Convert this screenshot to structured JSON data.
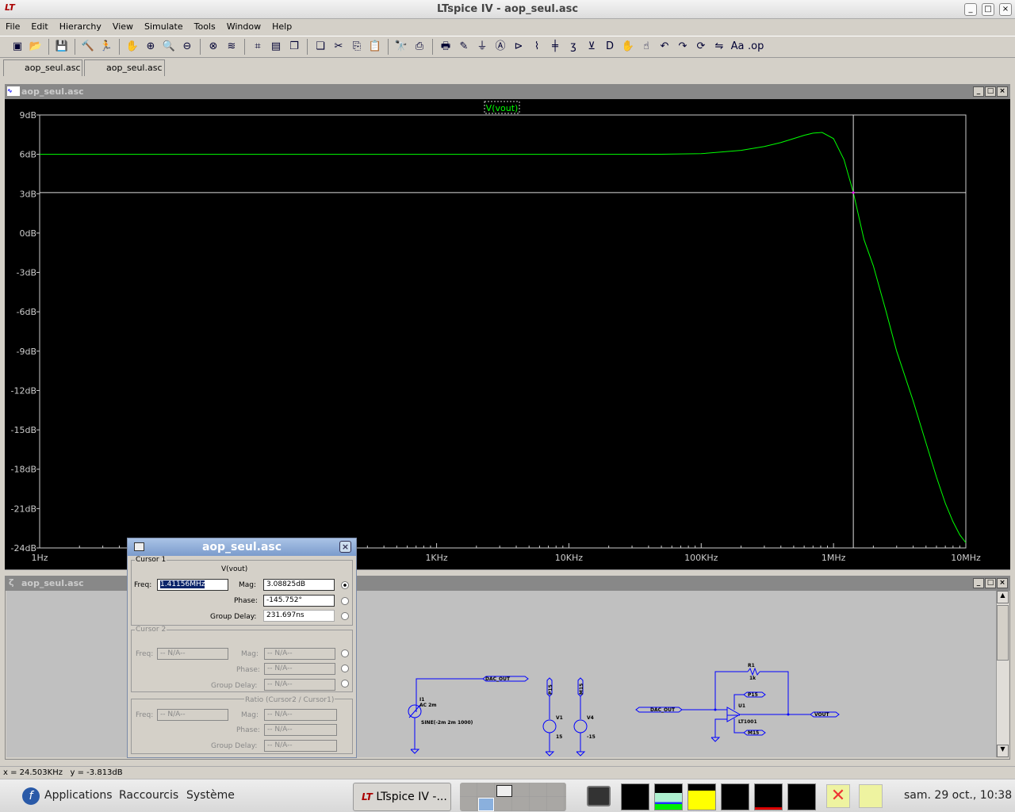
{
  "window": {
    "title": "LTspice IV - aop_seul.asc"
  },
  "menu": [
    "File",
    "Edit",
    "Hierarchy",
    "View",
    "Simulate",
    "Tools",
    "Window",
    "Help"
  ],
  "toolbar": [
    "new-schematic",
    "open",
    "save",
    "control-panel",
    "run",
    "halt",
    "zoom-in",
    "zoom-pan",
    "zoom-out",
    "zoom-cancel",
    "autorange",
    "mark-unref",
    "tile-horizontal",
    "cascade",
    "tile-vertical",
    "cut",
    "copy",
    "paste",
    "find",
    "print-setup",
    "print",
    "draw-wire",
    "ground",
    "label-net",
    "component",
    "resistor",
    "capacitor",
    "inductor",
    "diode",
    "component-add",
    "move",
    "drag",
    "undo",
    "redo",
    "rotate",
    "mirror",
    "text",
    "spice-directive"
  ],
  "tabs": [
    "aop_seul.asc",
    "aop_seul.asc"
  ],
  "plot_window": {
    "title": "aop_seul.asc",
    "trace_label": "V(vout)",
    "trace_color": "#00ff00"
  },
  "chart_data": {
    "type": "line",
    "xscale": "log",
    "xlim": [
      1,
      10000000
    ],
    "ylim": [
      -24,
      9
    ],
    "grid": "off",
    "yticks": [
      "9dB",
      "6dB",
      "3dB",
      "0dB",
      "-3dB",
      "-6dB",
      "-9dB",
      "-12dB",
      "-15dB",
      "-18dB",
      "-21dB",
      "-24dB"
    ],
    "ytick_values": [
      9,
      6,
      3,
      0,
      -3,
      -6,
      -9,
      -12,
      -15,
      -18,
      -21,
      -24
    ],
    "xticks": [
      "1Hz",
      "1KHz",
      "10KHz",
      "100KHz",
      "1MHz",
      "10MHz"
    ],
    "xtick_values": [
      1,
      1000,
      10000,
      100000,
      1000000,
      10000000
    ],
    "series": [
      {
        "name": "V(vout)",
        "x": [
          1,
          10,
          100,
          1000,
          10000,
          50000,
          100000,
          200000,
          300000,
          400000,
          500000,
          600000,
          700000,
          820000,
          1000000,
          1200000,
          1411560,
          1700000,
          2000000,
          2500000,
          3000000,
          4000000,
          5000000,
          6000000,
          7000000,
          8000000,
          9000000,
          10000000
        ],
        "y": [
          6,
          6,
          6,
          6,
          6,
          6.01,
          6.05,
          6.3,
          6.6,
          6.9,
          7.2,
          7.45,
          7.62,
          7.67,
          7.2,
          5.6,
          3.09,
          -0.5,
          -2.5,
          -6,
          -9,
          -12.8,
          -16,
          -18.6,
          -20.6,
          -22,
          -23,
          -23.6
        ]
      }
    ],
    "cursor": {
      "x": 1411560,
      "y": 3.08825
    }
  },
  "cursor_dialog": {
    "title": "aop_seul.asc",
    "cursor1": {
      "legend": "Cursor 1",
      "trace": "V(vout)",
      "freq_label": "Freq:",
      "freq": "1.41156MHz",
      "mag_label": "Mag:",
      "mag": "3.08825dB",
      "phase_label": "Phase:",
      "phase": "-145.752°",
      "gd_label": "Group Delay:",
      "gd": "231.697ns"
    },
    "cursor2": {
      "legend": "Cursor 2",
      "freq_label": "Freq:",
      "freq": "-- N/A--",
      "mag_label": "Mag:",
      "mag": "-- N/A--",
      "phase_label": "Phase:",
      "phase": "-- N/A--",
      "gd_label": "Group Delay:",
      "gd": "-- N/A--"
    },
    "ratio": {
      "legend": "Ratio (Cursor2 / Cursor1)",
      "freq_label": "Freq:",
      "freq": "-- N/A--",
      "mag_label": "Mag:",
      "mag": "-- N/A--",
      "phase_label": "Phase:",
      "phase": "-- N/A--",
      "gd_label": "Group Delay:",
      "gd": "-- N/A--"
    }
  },
  "schematic_window": {
    "title": "aop_seul.asc",
    "labels": {
      "dac_out": "DAC_OUT",
      "i1": "I1",
      "i1_ac": "AC 2m",
      "i1_sine": "SINE(-2m 2m 1000)",
      "p15": "P15",
      "m15": "M15",
      "v1": "V1",
      "v1_val": "15",
      "v4": "V4",
      "v4_val": "-15",
      "r1": "R1",
      "r1_val": "1k",
      "u1": "U1",
      "u1_model": "LT1001",
      "vout": "VOUT"
    }
  },
  "status": {
    "x": "x = 24.503KHz",
    "y": "y = -3.813dB"
  },
  "taskbar": {
    "applications": "Applications",
    "shortcuts": "Raccourcis",
    "system": "Système",
    "task": "LTspice IV -...",
    "clock": "sam. 29 oct., 10:38"
  }
}
